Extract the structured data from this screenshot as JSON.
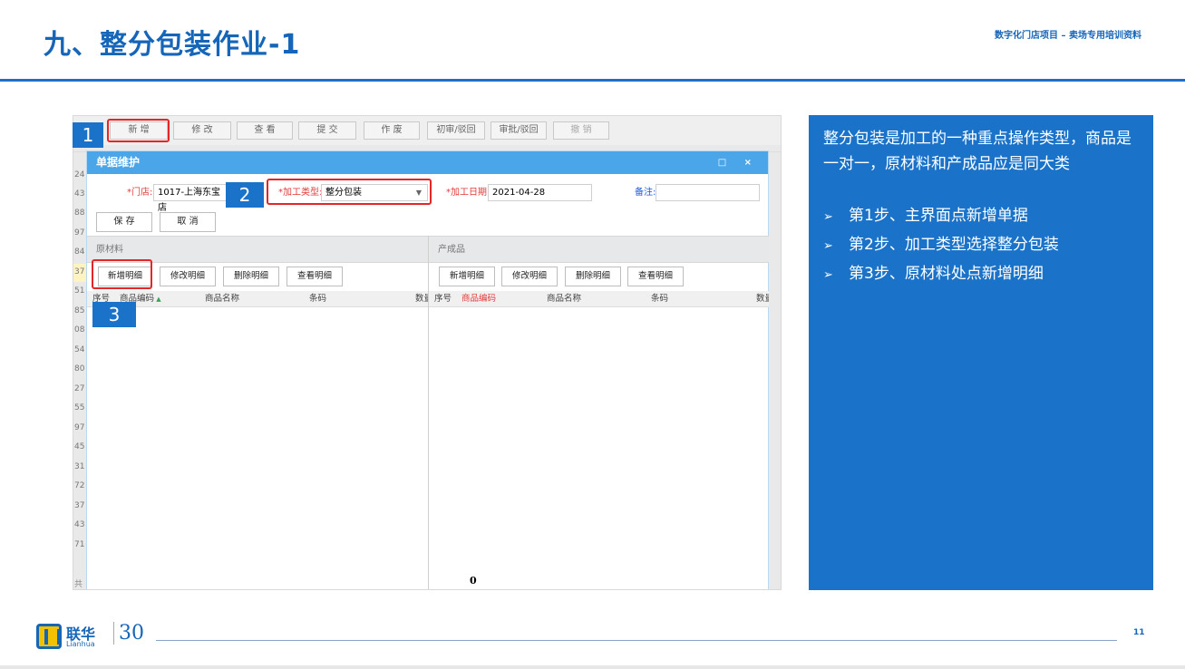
{
  "slide": {
    "title": "九、整分包装作业-1",
    "subtitle": "数字化门店项目 – 卖场专用培训资料",
    "page_number": "11"
  },
  "toolbar": {
    "buttons": [
      {
        "label": "新 增",
        "enabled": true
      },
      {
        "label": "修 改",
        "enabled": true
      },
      {
        "label": "查 看",
        "enabled": true
      },
      {
        "label": "提 交",
        "enabled": true
      },
      {
        "label": "作 废",
        "enabled": true
      },
      {
        "label": "初审/驳回",
        "enabled": true
      },
      {
        "label": "审批/驳回",
        "enabled": true
      },
      {
        "label": "撤 销",
        "enabled": false
      }
    ]
  },
  "left_list": {
    "numbers": [
      "24",
      "43",
      "88",
      "97",
      "84",
      "37",
      "51",
      "85",
      "08",
      "54",
      "80",
      "27",
      "55",
      "97",
      "45",
      "31",
      "72",
      "37",
      "43",
      "71"
    ],
    "footer": "共"
  },
  "modal": {
    "title": "单据维护",
    "controls": "□ ×",
    "store_label": "*门店:",
    "store_value": "1017-上海东宝店",
    "type_label": "*加工类型:",
    "type_value": "整分包装",
    "date_label": "*加工日期:",
    "date_value": "2021-04-28",
    "remark_label": "备注:",
    "remark_value": "",
    "save_label": "保 存",
    "cancel_label": "取 消",
    "raw": {
      "title": "原材料",
      "buttons": [
        "新增明细",
        "修改明细",
        "删除明细",
        "查看明细"
      ],
      "columns": [
        "序号",
        "商品编码",
        "商品名称",
        "条码",
        "数量"
      ]
    },
    "product": {
      "title": "产成品",
      "buttons": [
        "新增明细",
        "修改明细",
        "删除明细",
        "查看明细"
      ],
      "columns": [
        "序号",
        "商品编码",
        "商品名称",
        "条码",
        "数量"
      ]
    },
    "count": "0"
  },
  "steps": [
    "1",
    "2",
    "3"
  ],
  "note": {
    "intro": "整分包装是加工的一种重点操作类型，商品是一对一，原材料和产成品应是同大类",
    "bullet_symbol": "➢",
    "items": [
      "第1步、主界面点新增单据",
      "第2步、加工类型选择整分包装",
      "第3步、原材料处点新增明细"
    ]
  },
  "logo": {
    "cn": "联华",
    "en": "Lianhua",
    "anniversary": "30"
  },
  "colors": {
    "brand_blue": "#1565b8",
    "panel_blue": "#1a73c9",
    "modal_header": "#4aa6e8",
    "callout_red": "#e32626",
    "required_red": "#e33b3b"
  }
}
